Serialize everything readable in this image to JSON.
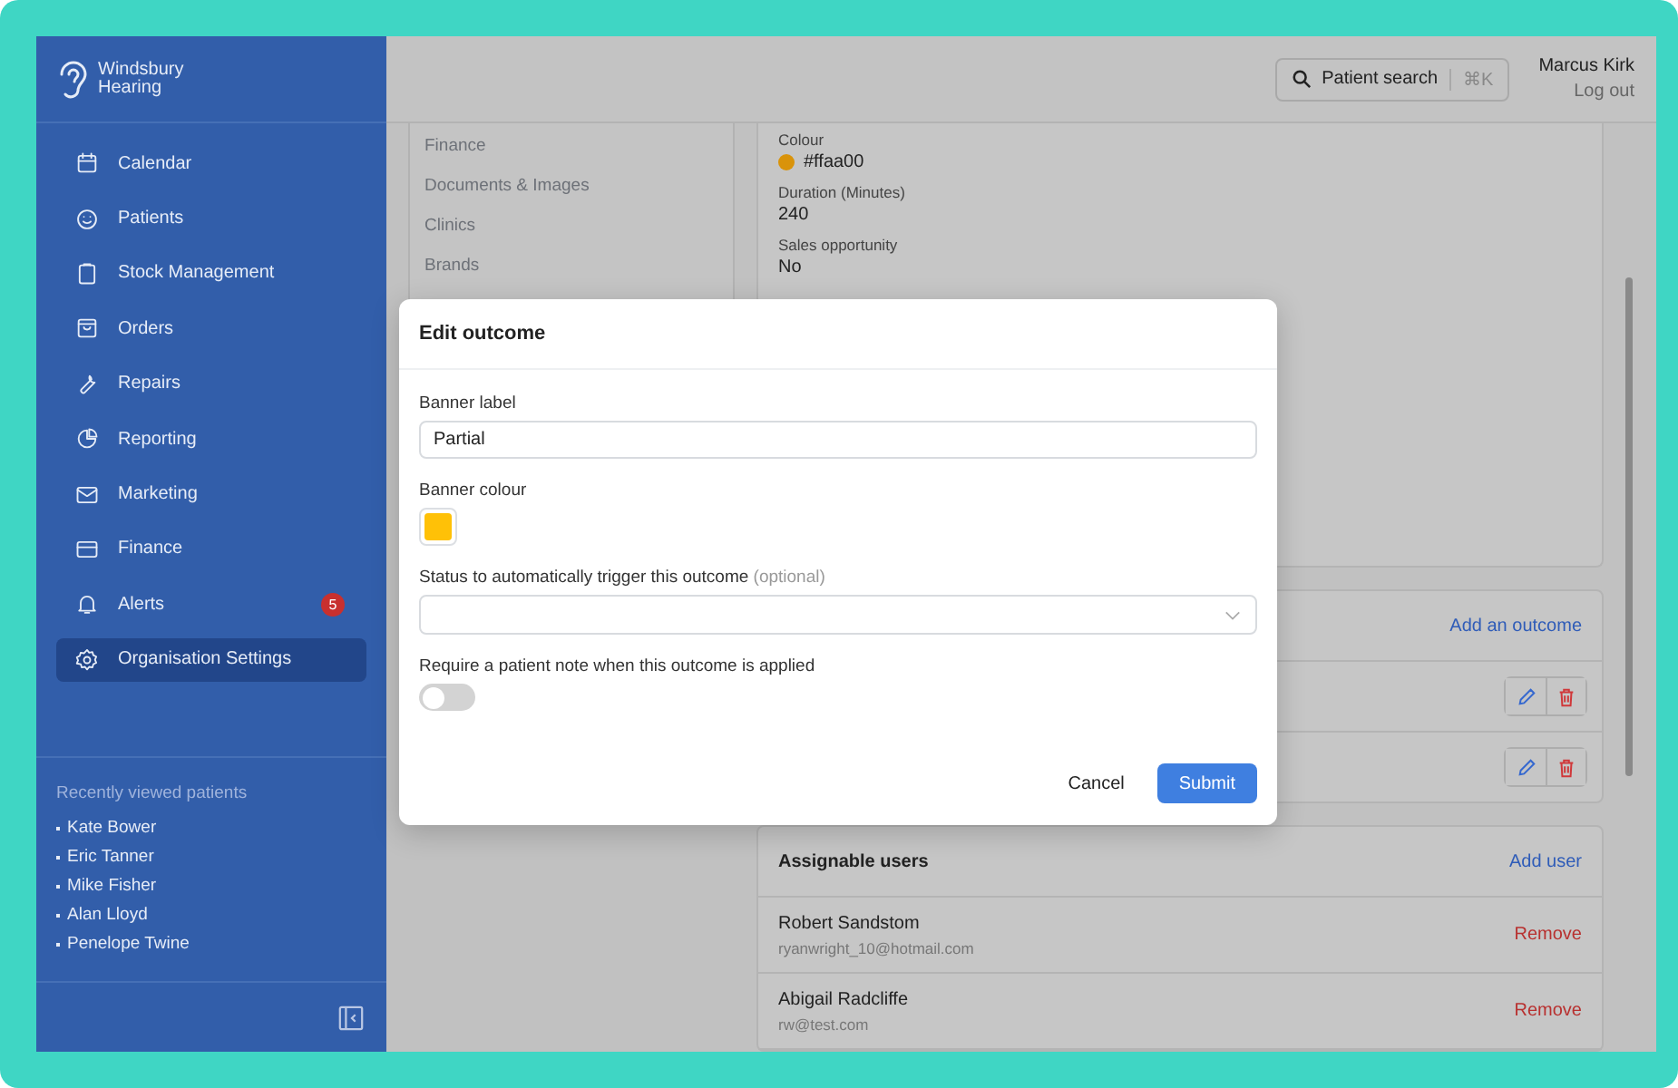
{
  "brand": {
    "name": "Windsbury Hearing"
  },
  "nav": [
    {
      "label": "Calendar",
      "selected": false
    },
    {
      "label": "Patients",
      "selected": false
    },
    {
      "label": "Stock Management",
      "selected": false
    },
    {
      "label": "Orders",
      "selected": false
    },
    {
      "label": "Repairs",
      "selected": false
    },
    {
      "label": "Reporting",
      "selected": false
    },
    {
      "label": "Marketing",
      "selected": false
    },
    {
      "label": "Finance",
      "selected": false
    },
    {
      "label": "Alerts",
      "selected": false,
      "badge": "5"
    },
    {
      "label": "Organisation Settings",
      "selected": true
    }
  ],
  "recent": {
    "title": "Recently viewed patients",
    "patients": [
      "Kate Bower",
      "Eric Tanner",
      "Mike Fisher",
      "Alan Lloyd",
      "Penelope Twine"
    ]
  },
  "header": {
    "search": "Patient search",
    "shortcut": "⌘K",
    "user": "Marcus Kirk",
    "logout": "Log out"
  },
  "settings_menu": [
    "Finance",
    "Documents & Images",
    "Clinics",
    "Brands"
  ],
  "details": [
    {
      "label": "Colour",
      "value": "#ffaa00",
      "color": "#d9930a"
    },
    {
      "label": "Duration (Minutes)",
      "value": "240"
    },
    {
      "label": "Sales opportunity",
      "value": "No"
    }
  ],
  "outcomes": {
    "action": "Add an outcome"
  },
  "users": {
    "title": "Assignable users",
    "action": "Add user",
    "list": [
      {
        "name": "Robert Sandstom",
        "email": "ryanwright_10@hotmail.com",
        "action": "Remove"
      },
      {
        "name": "Abigail Radcliffe",
        "email": "rw@test.com",
        "action": "Remove"
      }
    ]
  },
  "modal": {
    "title": "Edit outcome",
    "label_field": {
      "label": "Banner label",
      "value": "Partial"
    },
    "colour_field": {
      "label": "Banner colour",
      "color": "#ffc107"
    },
    "status_field": {
      "label": "Status to automatically trigger this outcome",
      "hint": "(optional)"
    },
    "note_toggle": {
      "label": "Require a patient note when this outcome is applied",
      "on": false
    },
    "buttons": [
      {
        "label": "Cancel",
        "kind": "secondary"
      },
      {
        "label": "Submit",
        "kind": "primary"
      }
    ]
  }
}
